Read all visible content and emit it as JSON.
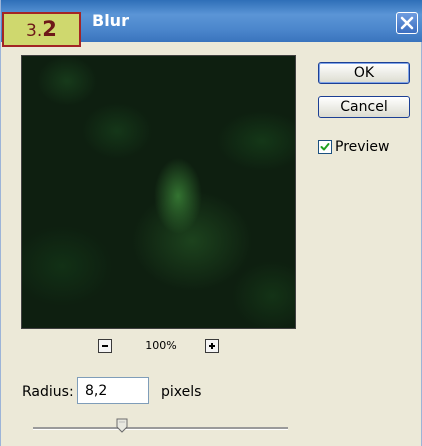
{
  "dialog": {
    "title": "Blur",
    "step_badge": {
      "major": "3.",
      "minor": "2"
    },
    "zoom_level": "100%",
    "buttons": {
      "ok": "OK",
      "cancel": "Cancel"
    },
    "preview_checkbox": {
      "label": "Preview",
      "checked": true
    },
    "radius": {
      "label": "Radius:",
      "value": "8,2",
      "units": "pixels"
    },
    "slider": {
      "fraction": 0.35
    }
  },
  "icons": {
    "close": "close-icon",
    "zoom_out": "minus-icon",
    "zoom_in": "plus-icon",
    "check": "checkmark-icon",
    "slider_thumb": "slider-thumb-icon"
  },
  "colors": {
    "titlebar": "#3a74bd",
    "dialog_bg": "#ece9d8",
    "badge_bg": "#cfd86e",
    "badge_border": "#a32525",
    "checkmark": "#21a121"
  }
}
